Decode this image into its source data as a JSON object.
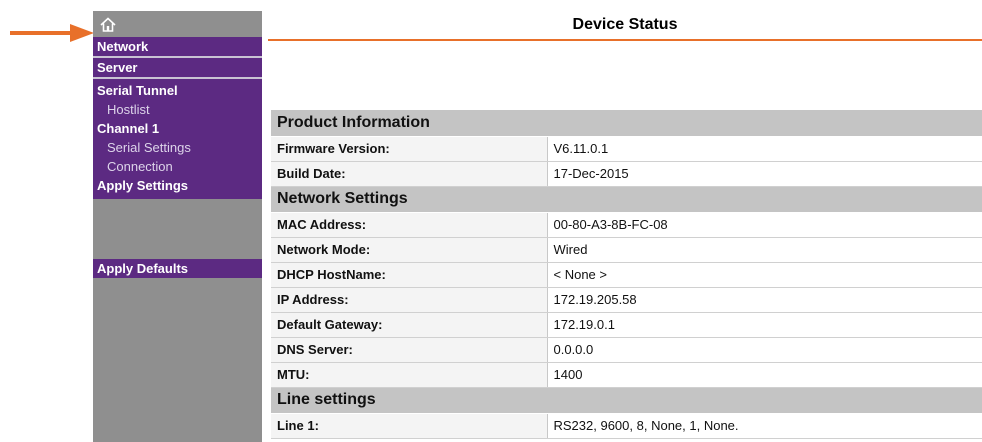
{
  "sidebar": {
    "home_icon": "home-icon",
    "items": [
      {
        "label": "Network"
      },
      {
        "label": "Server"
      },
      {
        "label": "Serial Tunnel"
      },
      {
        "label": "Hostlist"
      },
      {
        "label": "Channel 1"
      },
      {
        "label": "Serial Settings"
      },
      {
        "label": "Connection"
      },
      {
        "label": "Apply Settings"
      },
      {
        "label": "Apply Defaults"
      }
    ]
  },
  "main": {
    "title": "Device Status",
    "sections": [
      {
        "heading": "Product Information",
        "rows": [
          {
            "label": "Firmware Version:",
            "value": "V6.11.0.1"
          },
          {
            "label": "Build Date:",
            "value": "17-Dec-2015"
          }
        ]
      },
      {
        "heading": "Network Settings",
        "rows": [
          {
            "label": "MAC Address:",
            "value": "00-80-A3-8B-FC-08"
          },
          {
            "label": "Network Mode:",
            "value": "Wired"
          },
          {
            "label": "DHCP HostName:",
            "value": "< None >"
          },
          {
            "label": "IP Address:",
            "value": "172.19.205.58"
          },
          {
            "label": "Default Gateway:",
            "value": "172.19.0.1"
          },
          {
            "label": "DNS Server:",
            "value": "0.0.0.0"
          },
          {
            "label": "MTU:",
            "value": "1400"
          }
        ]
      },
      {
        "heading": "Line settings",
        "rows": [
          {
            "label": "Line 1:",
            "value": "RS232, 9600, 8, None, 1, None."
          }
        ]
      }
    ]
  },
  "colors": {
    "sidebar_purple": "#5c2a82",
    "sidebar_gray": "#8f8f8f",
    "accent_orange": "#e8702a",
    "section_gray": "#c4c4c4"
  }
}
